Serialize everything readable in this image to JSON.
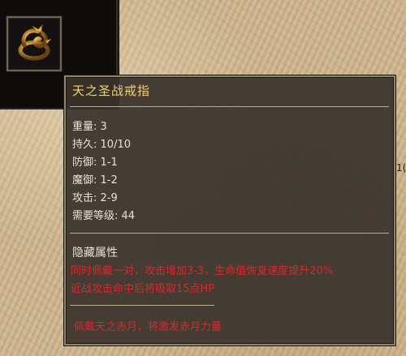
{
  "item": {
    "name": "天之圣战戒指",
    "icon": "gold-dragon-ring-icon"
  },
  "stats": [
    {
      "label": "重量",
      "value": "3"
    },
    {
      "label": "持久",
      "value": "10/10"
    },
    {
      "label": "防御",
      "value": "1-1"
    },
    {
      "label": "魔御",
      "value": "1-2"
    },
    {
      "label": "攻击",
      "value": "2-9"
    },
    {
      "label": "需要等级",
      "value": "44"
    }
  ],
  "hidden": {
    "title": "隐藏属性",
    "lines": [
      "同时佩戴一对，攻击增加3-3，生命值恢复速度提升20%",
      "近战攻击命中后将吸取15点HP"
    ],
    "set_bonus": "佩戴天之赤月，将激发赤月力量"
  },
  "edge_text": "1("
}
